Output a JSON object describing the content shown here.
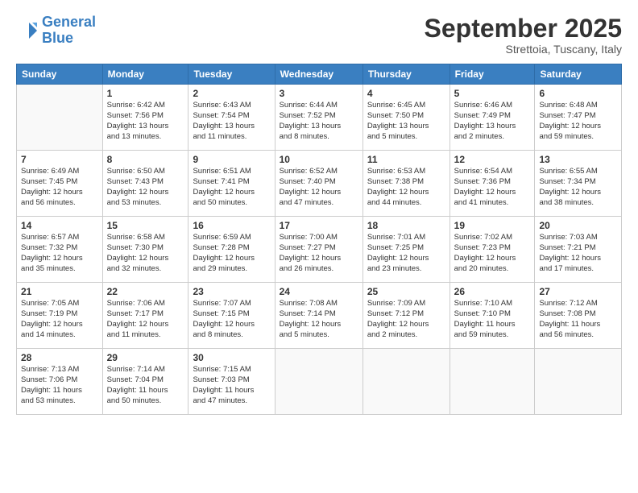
{
  "header": {
    "logo_line1": "General",
    "logo_line2": "Blue",
    "month": "September 2025",
    "location": "Strettoia, Tuscany, Italy"
  },
  "weekdays": [
    "Sunday",
    "Monday",
    "Tuesday",
    "Wednesday",
    "Thursday",
    "Friday",
    "Saturday"
  ],
  "weeks": [
    [
      {
        "day": "",
        "info": ""
      },
      {
        "day": "1",
        "info": "Sunrise: 6:42 AM\nSunset: 7:56 PM\nDaylight: 13 hours\nand 13 minutes."
      },
      {
        "day": "2",
        "info": "Sunrise: 6:43 AM\nSunset: 7:54 PM\nDaylight: 13 hours\nand 11 minutes."
      },
      {
        "day": "3",
        "info": "Sunrise: 6:44 AM\nSunset: 7:52 PM\nDaylight: 13 hours\nand 8 minutes."
      },
      {
        "day": "4",
        "info": "Sunrise: 6:45 AM\nSunset: 7:50 PM\nDaylight: 13 hours\nand 5 minutes."
      },
      {
        "day": "5",
        "info": "Sunrise: 6:46 AM\nSunset: 7:49 PM\nDaylight: 13 hours\nand 2 minutes."
      },
      {
        "day": "6",
        "info": "Sunrise: 6:48 AM\nSunset: 7:47 PM\nDaylight: 12 hours\nand 59 minutes."
      }
    ],
    [
      {
        "day": "7",
        "info": "Sunrise: 6:49 AM\nSunset: 7:45 PM\nDaylight: 12 hours\nand 56 minutes."
      },
      {
        "day": "8",
        "info": "Sunrise: 6:50 AM\nSunset: 7:43 PM\nDaylight: 12 hours\nand 53 minutes."
      },
      {
        "day": "9",
        "info": "Sunrise: 6:51 AM\nSunset: 7:41 PM\nDaylight: 12 hours\nand 50 minutes."
      },
      {
        "day": "10",
        "info": "Sunrise: 6:52 AM\nSunset: 7:40 PM\nDaylight: 12 hours\nand 47 minutes."
      },
      {
        "day": "11",
        "info": "Sunrise: 6:53 AM\nSunset: 7:38 PM\nDaylight: 12 hours\nand 44 minutes."
      },
      {
        "day": "12",
        "info": "Sunrise: 6:54 AM\nSunset: 7:36 PM\nDaylight: 12 hours\nand 41 minutes."
      },
      {
        "day": "13",
        "info": "Sunrise: 6:55 AM\nSunset: 7:34 PM\nDaylight: 12 hours\nand 38 minutes."
      }
    ],
    [
      {
        "day": "14",
        "info": "Sunrise: 6:57 AM\nSunset: 7:32 PM\nDaylight: 12 hours\nand 35 minutes."
      },
      {
        "day": "15",
        "info": "Sunrise: 6:58 AM\nSunset: 7:30 PM\nDaylight: 12 hours\nand 32 minutes."
      },
      {
        "day": "16",
        "info": "Sunrise: 6:59 AM\nSunset: 7:28 PM\nDaylight: 12 hours\nand 29 minutes."
      },
      {
        "day": "17",
        "info": "Sunrise: 7:00 AM\nSunset: 7:27 PM\nDaylight: 12 hours\nand 26 minutes."
      },
      {
        "day": "18",
        "info": "Sunrise: 7:01 AM\nSunset: 7:25 PM\nDaylight: 12 hours\nand 23 minutes."
      },
      {
        "day": "19",
        "info": "Sunrise: 7:02 AM\nSunset: 7:23 PM\nDaylight: 12 hours\nand 20 minutes."
      },
      {
        "day": "20",
        "info": "Sunrise: 7:03 AM\nSunset: 7:21 PM\nDaylight: 12 hours\nand 17 minutes."
      }
    ],
    [
      {
        "day": "21",
        "info": "Sunrise: 7:05 AM\nSunset: 7:19 PM\nDaylight: 12 hours\nand 14 minutes."
      },
      {
        "day": "22",
        "info": "Sunrise: 7:06 AM\nSunset: 7:17 PM\nDaylight: 12 hours\nand 11 minutes."
      },
      {
        "day": "23",
        "info": "Sunrise: 7:07 AM\nSunset: 7:15 PM\nDaylight: 12 hours\nand 8 minutes."
      },
      {
        "day": "24",
        "info": "Sunrise: 7:08 AM\nSunset: 7:14 PM\nDaylight: 12 hours\nand 5 minutes."
      },
      {
        "day": "25",
        "info": "Sunrise: 7:09 AM\nSunset: 7:12 PM\nDaylight: 12 hours\nand 2 minutes."
      },
      {
        "day": "26",
        "info": "Sunrise: 7:10 AM\nSunset: 7:10 PM\nDaylight: 11 hours\nand 59 minutes."
      },
      {
        "day": "27",
        "info": "Sunrise: 7:12 AM\nSunset: 7:08 PM\nDaylight: 11 hours\nand 56 minutes."
      }
    ],
    [
      {
        "day": "28",
        "info": "Sunrise: 7:13 AM\nSunset: 7:06 PM\nDaylight: 11 hours\nand 53 minutes."
      },
      {
        "day": "29",
        "info": "Sunrise: 7:14 AM\nSunset: 7:04 PM\nDaylight: 11 hours\nand 50 minutes."
      },
      {
        "day": "30",
        "info": "Sunrise: 7:15 AM\nSunset: 7:03 PM\nDaylight: 11 hours\nand 47 minutes."
      },
      {
        "day": "",
        "info": ""
      },
      {
        "day": "",
        "info": ""
      },
      {
        "day": "",
        "info": ""
      },
      {
        "day": "",
        "info": ""
      }
    ]
  ]
}
